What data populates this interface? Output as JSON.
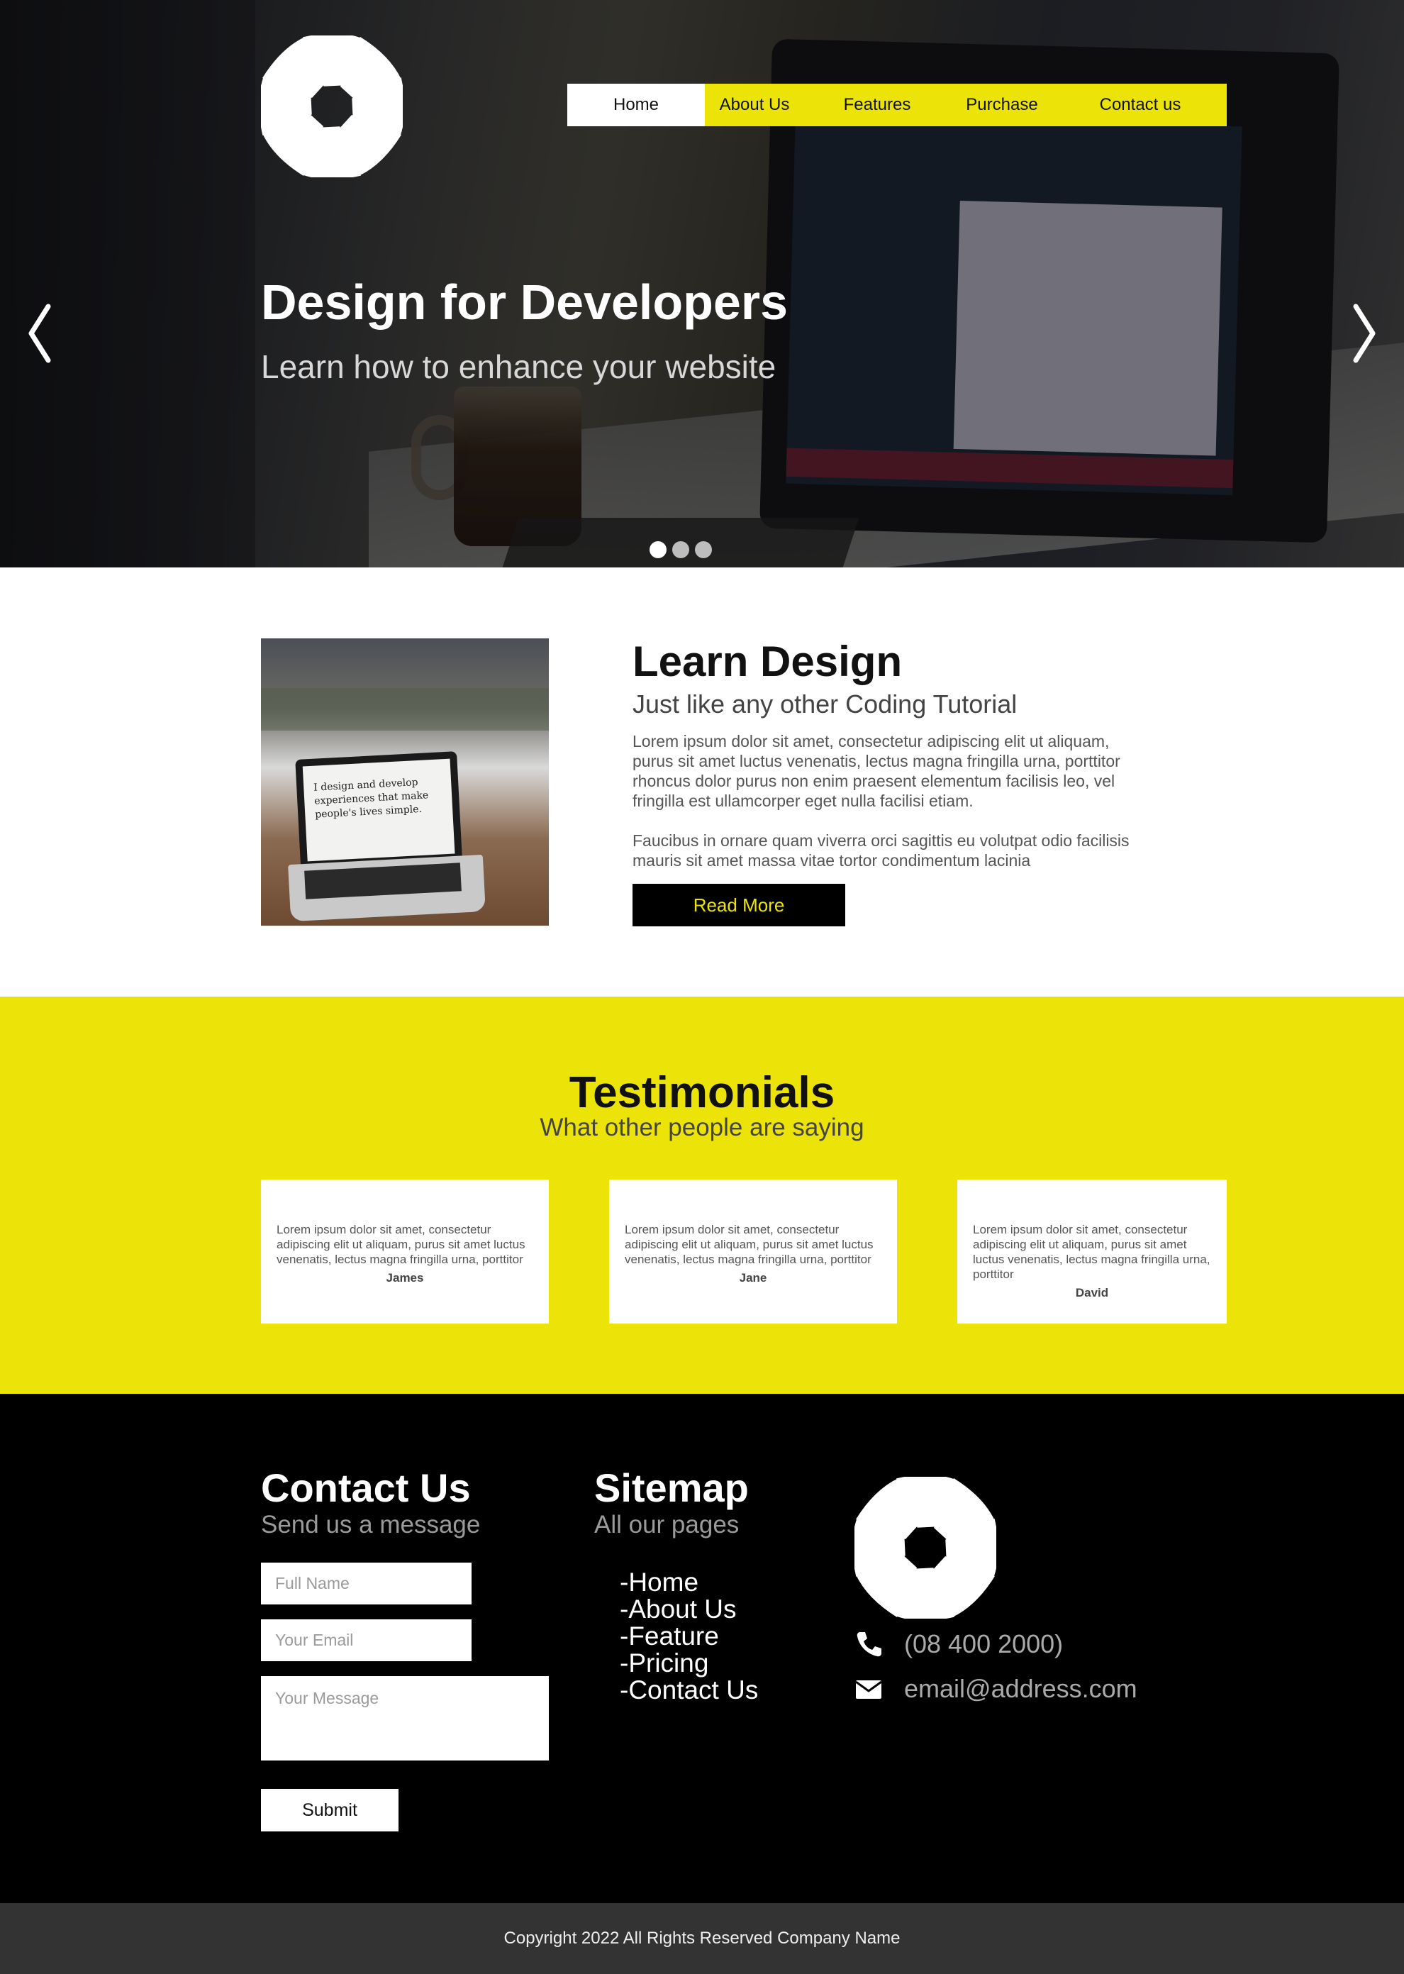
{
  "colors": {
    "accent": "#ece408",
    "dark": "#000000",
    "copyright_bg": "#333333"
  },
  "logo_icon": "pinwheel-logo",
  "nav": {
    "items": [
      "Home",
      "About Us",
      "Features",
      "Purchase",
      "Contact us"
    ],
    "active": "Home"
  },
  "hero": {
    "title": "Design for Developers",
    "subtitle": "Learn how to enhance your website",
    "prev_icon": "chevron-left-icon",
    "next_icon": "chevron-right-icon",
    "slides": 3,
    "active_slide": 1
  },
  "about": {
    "image_screen_text": "I design and develop experiences that make people's lives simple.",
    "title": "Learn Design",
    "subtitle": "Just like any other Coding Tutorial",
    "paragraph1": "Lorem ipsum dolor sit amet, consectetur adipiscing elit ut aliquam, purus sit amet luctus venenatis, lectus magna fringilla urna, porttitor rhoncus dolor purus non enim praesent elementum facilisis leo, vel fringilla est ullamcorper eget nulla facilisi etiam.",
    "paragraph2": "Faucibus in ornare quam viverra orci sagittis eu volutpat odio facilisis mauris sit amet massa vitae tortor condimentum lacinia",
    "button": "Read More"
  },
  "testimonials": {
    "title": "Testimonials",
    "subtitle": "What other people are saying",
    "items": [
      {
        "quote": "Lorem ipsum dolor sit amet, consectetur adipiscing elit ut aliquam, purus sit amet luctus venenatis, lectus magna fringilla urna, porttitor",
        "name": "James"
      },
      {
        "quote": "Lorem ipsum dolor sit amet, consectetur adipiscing elit ut aliquam, purus sit amet luctus venenatis, lectus magna fringilla urna, porttitor",
        "name": "Jane"
      },
      {
        "quote": "Lorem ipsum dolor sit amet, consectetur adipiscing elit ut aliquam, purus sit amet luctus venenatis, lectus magna fringilla urna, porttitor",
        "name": "David"
      }
    ]
  },
  "contact": {
    "title": "Contact Us",
    "subtitle": "Send us a message",
    "name_placeholder": "Full Name",
    "email_placeholder": "Your Email",
    "message_placeholder": "Your Message",
    "submit": "Submit"
  },
  "sitemap": {
    "title": "Sitemap",
    "subtitle": "All our pages",
    "links": [
      "-Home",
      "-About Us",
      "-Feature",
      "-Pricing",
      "-Contact Us"
    ]
  },
  "info": {
    "phone_icon": "phone-icon",
    "phone": "(08 400 2000)",
    "email_icon": "envelope-icon",
    "email": "email@address.com"
  },
  "copyright": "Copyright 2022 All Rights Reserved Company Name"
}
